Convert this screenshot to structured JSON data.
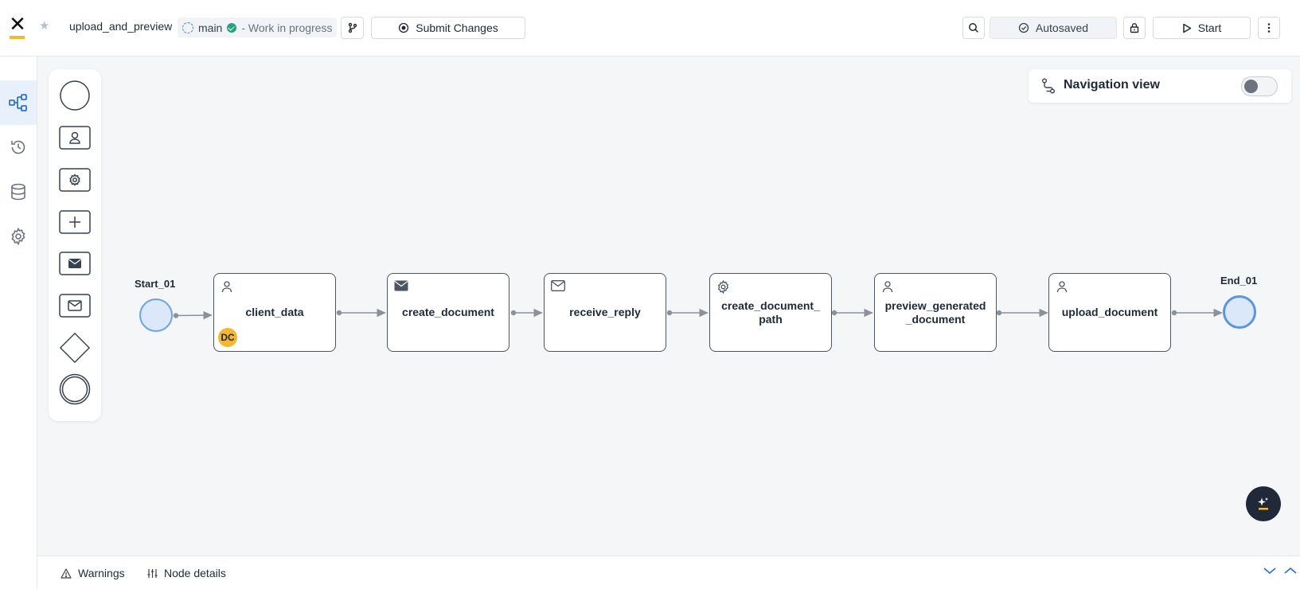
{
  "header": {
    "process_name": "upload_and_preview",
    "branch": "main",
    "status": "- Work in progress",
    "submit_label": "Submit Changes",
    "autosave_label": "Autosaved",
    "start_label": "Start"
  },
  "icons": {
    "logo": "x-logo",
    "star": "star-icon",
    "branch": "git-branch-icon",
    "submit": "record-icon",
    "search": "search-icon",
    "autosave": "check-circle-icon",
    "lock": "lock-icon",
    "start": "play-icon",
    "more": "kebab-icon"
  },
  "rail": {
    "items": [
      "process-designer",
      "history",
      "data-model",
      "settings"
    ],
    "active": "process-designer"
  },
  "palette": {
    "items": [
      "start-event",
      "user-task",
      "service-task",
      "subprocess",
      "send-message-task",
      "receive-message-task",
      "gateway",
      "end-event"
    ]
  },
  "nav_view": {
    "title": "Navigation view",
    "enabled": false
  },
  "flow": {
    "start_event": "Start_01",
    "end_event": "End_01",
    "nodes": [
      {
        "label": "client_data",
        "type": "user-task",
        "badge": "DC"
      },
      {
        "label": "create_document",
        "type": "send-message-task"
      },
      {
        "label": "receive_reply",
        "type": "receive-message-task"
      },
      {
        "label": "create_document_path",
        "type": "service-task"
      },
      {
        "label": "preview_generated_document",
        "type": "user-task"
      },
      {
        "label": "upload_document",
        "type": "user-task"
      }
    ]
  },
  "bottom": {
    "warnings_label": "Warnings",
    "node_details_label": "Node details"
  },
  "colors": {
    "accent": "#3b82f6",
    "event_fill": "#dbe8fa",
    "badge": "#f5b731",
    "status_ok": "#22a37a"
  }
}
